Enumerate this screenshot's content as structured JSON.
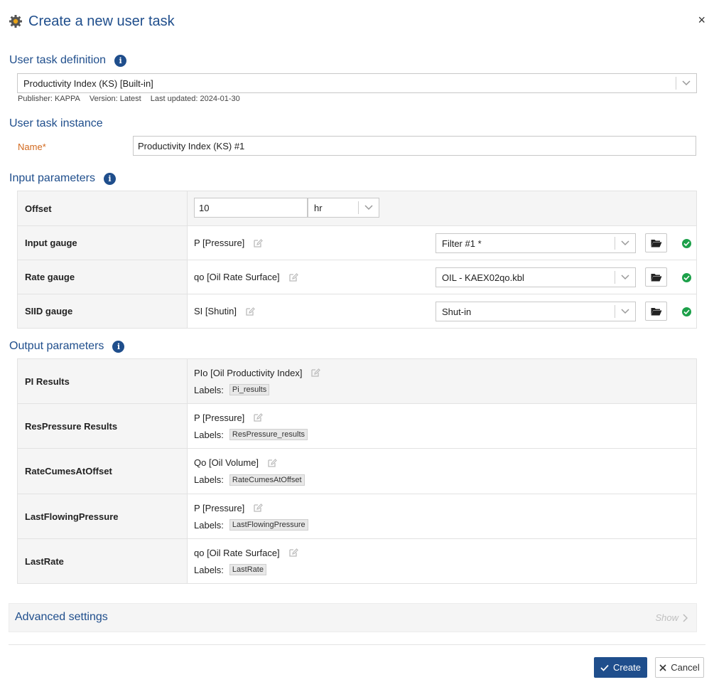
{
  "dialog": {
    "title": "Create a new user task",
    "close_label": "×"
  },
  "definition": {
    "heading": "User task definition",
    "selected": "Productivity Index (KS) [Built-in]",
    "publisher": "Publisher: KAPPA",
    "version": "Version: Latest",
    "updated": "Last updated: 2024-01-30"
  },
  "instance": {
    "heading": "User task instance",
    "name_label": "Name",
    "required_mark": "*",
    "name_value": "Productivity Index (KS) #1"
  },
  "inputs": {
    "heading": "Input parameters",
    "offset": {
      "label": "Offset",
      "value": "10",
      "unit": "hr"
    },
    "gauges": [
      {
        "label": "Input gauge",
        "channel": "P [Pressure]",
        "source": "Filter #1 *"
      },
      {
        "label": "Rate gauge",
        "channel": "qo [Oil Rate Surface]",
        "source": "OIL - KAEX02qo.kbl"
      },
      {
        "label": "SIID gauge",
        "channel": "SI [Shutin]",
        "source": "Shut-in"
      }
    ]
  },
  "outputs": {
    "heading": "Output parameters",
    "labels_prefix": "Labels:",
    "rows": [
      {
        "label": "PI Results",
        "channel": "PIo [Oil Productivity Index]",
        "tag": "Pi_results"
      },
      {
        "label": "ResPressure Results",
        "channel": "P [Pressure]",
        "tag": "ResPressure_results"
      },
      {
        "label": "RateCumesAtOffset",
        "channel": "Qo [Oil Volume]",
        "tag": "RateCumesAtOffset"
      },
      {
        "label": "LastFlowingPressure",
        "channel": "P [Pressure]",
        "tag": "LastFlowingPressure"
      },
      {
        "label": "LastRate",
        "channel": "qo [Oil Rate Surface]",
        "tag": "LastRate"
      }
    ]
  },
  "advanced": {
    "heading": "Advanced settings",
    "toggle_label": "Show"
  },
  "actions": {
    "create_label": "Create",
    "cancel_label": "Cancel"
  },
  "colors": {
    "accent": "#1f4e8c",
    "required": "#d2691e",
    "ok": "#1ca049"
  }
}
